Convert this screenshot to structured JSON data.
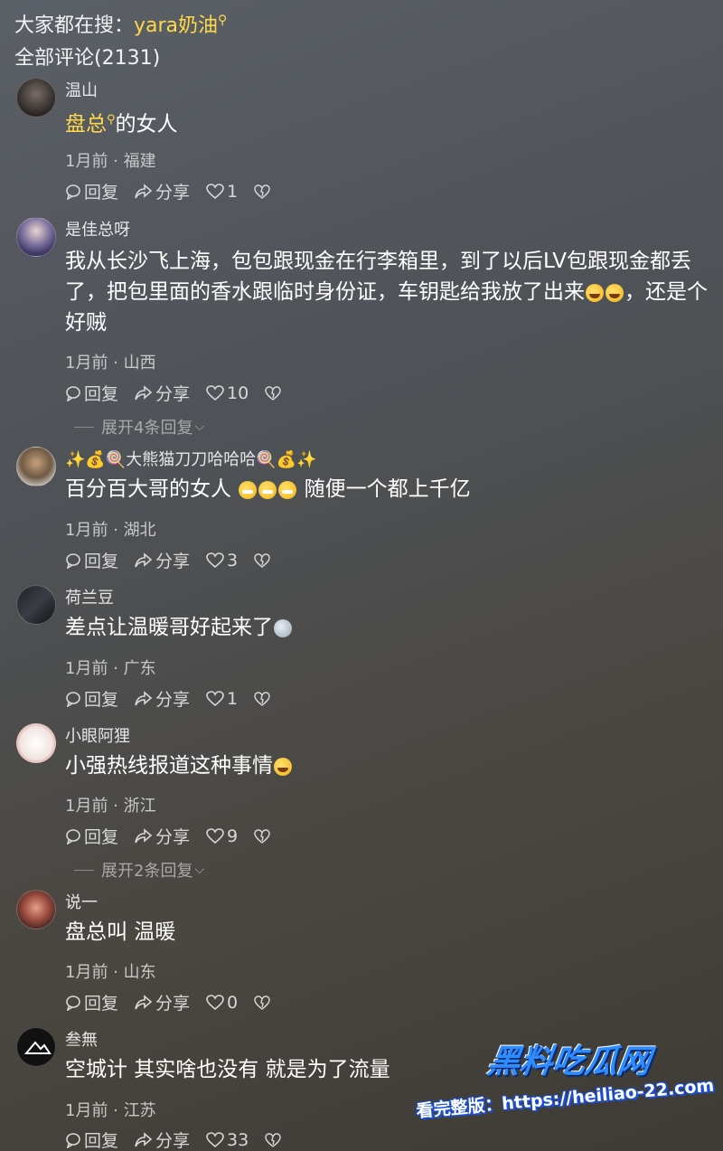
{
  "search": {
    "prefix": "大家都在搜：",
    "keyword": "yara奶油"
  },
  "comments_header": "全部评论(2131)",
  "labels": {
    "reply": "回复",
    "share": "分享"
  },
  "comments": [
    {
      "user": "温山",
      "keyword": "盘总",
      "text_after": "的女人",
      "meta": "1月前 · 福建",
      "likes": "1"
    },
    {
      "user": "是佳总呀",
      "text": "我从长沙飞上海，包包跟现金在行李箱里，到了以后LV包跟现金都丢了，把包里面的香水跟临时身份证，车钥匙给我放了出来",
      "text_tail": "，还是个好贼",
      "meta": "1月前 · 山西",
      "likes": "10",
      "expand": "展开4条回复"
    },
    {
      "user": "✨💰🍭大熊猫刀刀哈哈哈🍭💰✨",
      "text": "百分百大哥的女人",
      "text_tail": "随便一个都上千亿",
      "meta": "1月前 · 湖北",
      "likes": "3"
    },
    {
      "user": "荷兰豆",
      "text": "差点让温暖哥好起来了",
      "meta": "1月前 · 广东",
      "likes": "1"
    },
    {
      "user": "小眼阿狸",
      "text": "小强热线报道这种事情",
      "meta": "1月前 · 浙江",
      "likes": "9",
      "expand": "展开2条回复"
    },
    {
      "user": "说一",
      "text": "盘总叫 温暖",
      "meta": "1月前 · 山东",
      "likes": "0"
    },
    {
      "user": "叁無",
      "text": "空城计 其实啥也没有 就是为了流量",
      "meta": "1月前 · 江苏",
      "likes": "33"
    }
  ],
  "watermark": {
    "logo": "黑料吃瓜网",
    "url": "看完整版：https://heiliao-22.com"
  },
  "colors": {
    "keyword": "#ffd84a",
    "watermark_blue": "#2d8cff"
  },
  "icons": [
    "search-icon",
    "reply-icon",
    "share-icon",
    "heart-icon",
    "dislike-icon",
    "chevron-down-icon"
  ]
}
